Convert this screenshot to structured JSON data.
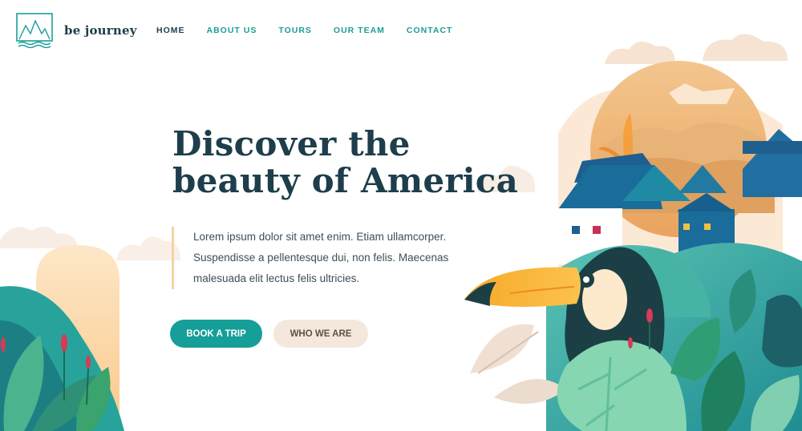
{
  "brand": {
    "name": "be journey"
  },
  "nav": [
    {
      "label": "HOME",
      "active": true
    },
    {
      "label": "ABOUT US",
      "active": false
    },
    {
      "label": "TOURS",
      "active": false
    },
    {
      "label": "OUR TEAM",
      "active": false
    },
    {
      "label": "CONTACT",
      "active": false
    }
  ],
  "hero": {
    "title_line1": "Discover the",
    "title_line2": "beauty of America",
    "intro_line1": "Lorem ipsum dolor sit amet enim. Etiam ullamcorper.",
    "intro_line2": "Suspendisse a pellentesque dui, non felis. Maecenas",
    "intro_line3": "malesuada elit lectus felis ultricies.",
    "primary_button": "BOOK A TRIP",
    "secondary_button": "WHO WE ARE"
  },
  "colors": {
    "accent": "#169e98",
    "heading": "#1d3e4a",
    "secondary_button_bg": "#f4e8dc",
    "intro_bar": "#f6d3a3"
  },
  "icons": {
    "logo": "mountain-logo-icon",
    "illustration": "toucan-village-illustration"
  }
}
